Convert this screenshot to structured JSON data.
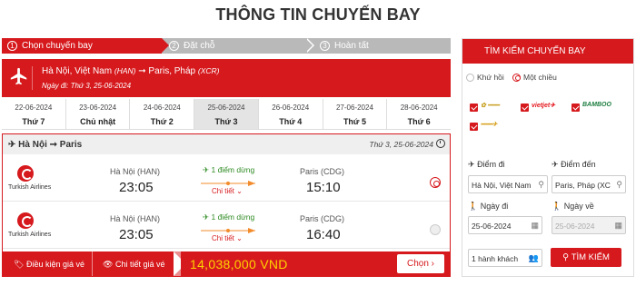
{
  "page_title": "THÔNG TIN CHUYẾN BAY",
  "steps": [
    {
      "num": "1",
      "label": "Chọn chuyến bay"
    },
    {
      "num": "2",
      "label": "Đặt chỗ"
    },
    {
      "num": "3",
      "label": "Hoàn tất"
    }
  ],
  "route": {
    "from": "Hà Nội, Việt Nam",
    "from_code": "(HAN)",
    "to": "Paris, Pháp",
    "to_code": "(XCR)",
    "date_text": "Ngày đi: Thứ 3, 25-06-2024"
  },
  "dates": [
    {
      "date": "22-06-2024",
      "weekday": "Thứ 7"
    },
    {
      "date": "23-06-2024",
      "weekday": "Chủ nhật"
    },
    {
      "date": "24-06-2024",
      "weekday": "Thứ 2"
    },
    {
      "date": "25-06-2024",
      "weekday": "Thứ 3"
    },
    {
      "date": "26-06-2024",
      "weekday": "Thứ 4"
    },
    {
      "date": "27-06-2024",
      "weekday": "Thứ 5"
    },
    {
      "date": "28-06-2024",
      "weekday": "Thứ 6"
    }
  ],
  "flight_box": {
    "route_label": "Hà Nội ➞ Paris",
    "date_label": "Thứ 3, 25-06-2024"
  },
  "flights": [
    {
      "airline": "Turkish Airlines",
      "dep_city": "Hà Nội (HAN)",
      "dep_time": "23:05",
      "stops": "1 điểm dừng",
      "detail": "Chi tiết ⌄",
      "arr_city": "Paris (CDG)",
      "arr_time": "15:10"
    },
    {
      "airline": "Turkish Airlines",
      "dep_city": "Hà Nội (HAN)",
      "dep_time": "23:05",
      "stops": "1 điểm dừng",
      "detail": "Chi tiết ⌄",
      "arr_city": "Paris (CDG)",
      "arr_time": "16:40"
    }
  ],
  "footer": {
    "fare_rules": "Điều kiện giá vé",
    "fare_detail": "Chi tiết giá vé",
    "price": "14,038,000 VND",
    "choose": "Chọn ›"
  },
  "search": {
    "title": "TÌM KIẾM CHUYẾN BAY",
    "round_trip": "Khứ hồi",
    "one_way": "Một chiều",
    "airlines": [
      "Vietnam Airlines",
      "VietJet Air",
      "Bamboo",
      "Vietravel"
    ],
    "from_label": "Điểm đi",
    "to_label": "Điểm đến",
    "from_value": "Hà Nội, Việt Nam",
    "to_value": "Paris, Pháp (XC",
    "depart_label": "Ngày đi",
    "return_label": "Ngày về",
    "depart_value": "25-06-2024",
    "return_value": "25-06-2024",
    "passengers": "1 hành khách",
    "search_button": "TÌM KIẾM"
  },
  "colors": {
    "brand": "#d6191d",
    "stop_green": "#2e8b23",
    "price_yellow": "#ffd200"
  }
}
